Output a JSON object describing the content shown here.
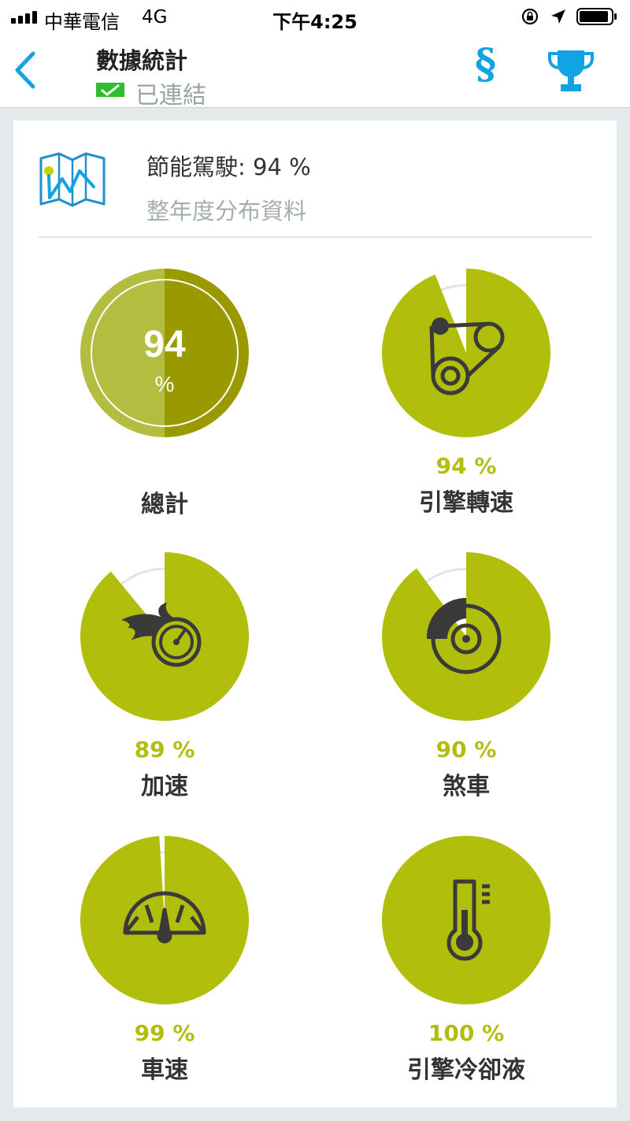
{
  "status_bar": {
    "carrier": "中華電信",
    "network": "4G",
    "time": "下午4:25"
  },
  "nav": {
    "title": "數據統計",
    "subtitle": "已連結",
    "para_symbol": "§"
  },
  "summary": {
    "title": "節能駕駛: 94 %",
    "subtitle": "整年度分布資料"
  },
  "colors": {
    "accent": "#b2be0c",
    "blue": "#12a3e2",
    "gauge_track": "#e0e6e7",
    "icon_dark": "#3a3a3a",
    "total_light": "#b3bd3f",
    "total_dark": "#9a9a00"
  },
  "total": {
    "value": "94",
    "unit": "%",
    "label": "總計",
    "fraction": 0.94
  },
  "gauges": [
    {
      "id": "rpm",
      "label": "引擎轉速",
      "percent_text": "94 %",
      "fraction": 0.94,
      "icon": "belt-drive-icon"
    },
    {
      "id": "accel",
      "label": "加速",
      "percent_text": "89 %",
      "fraction": 0.89,
      "icon": "speedometer-flame-icon"
    },
    {
      "id": "brake",
      "label": "煞車",
      "percent_text": "90 %",
      "fraction": 0.9,
      "icon": "brake-disc-icon"
    },
    {
      "id": "speed",
      "label": "車速",
      "percent_text": "99 %",
      "fraction": 0.99,
      "icon": "speed-dial-icon"
    },
    {
      "id": "coolant",
      "label": "引擎冷卻液",
      "percent_text": "100 %",
      "fraction": 1.0,
      "icon": "thermometer-icon"
    }
  ]
}
